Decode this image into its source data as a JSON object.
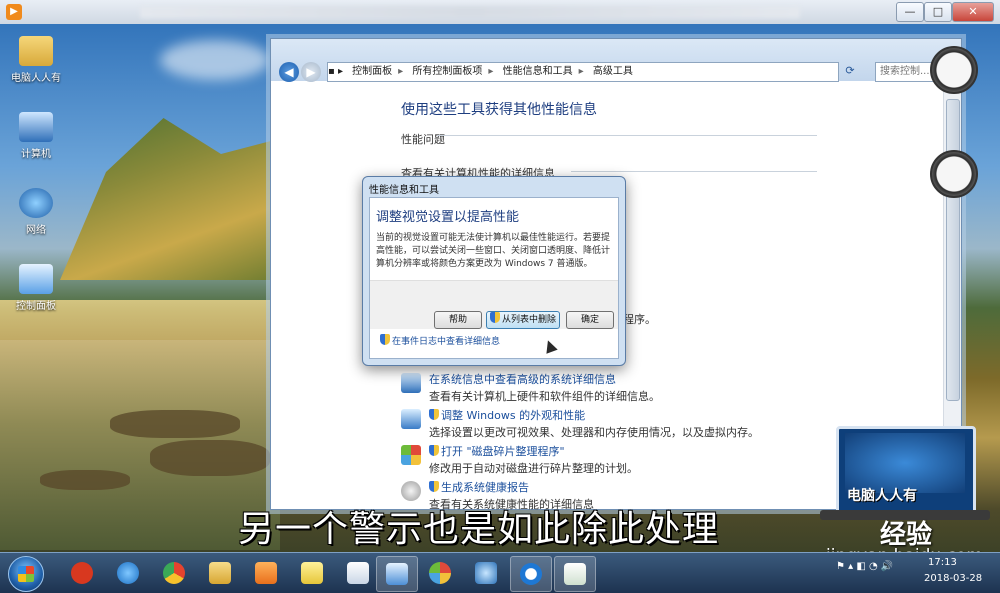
{
  "player": {
    "logo": "▶",
    "minimize": "—",
    "maximize": "□",
    "close": "✕"
  },
  "desktop_icons": [
    {
      "label": "电脑人人有"
    },
    {
      "label": "计算机"
    },
    {
      "label": "网络"
    },
    {
      "label": "控制面板"
    }
  ],
  "explorer": {
    "breadcrumb": [
      "控制面板",
      "所有控制面板项",
      "性能信息和工具",
      "高级工具"
    ],
    "search_placeholder": "搜索控制...",
    "pane_title": "使用这些工具获得其他性能信息",
    "group_issues": "性能问题",
    "group_details": "查看有关计算机性能的详细信息",
    "partial_text": "程序。",
    "tools": [
      {
        "link": "在系统信息中查看高级的系统详细信息",
        "desc": "查看有关计算机上硬件和软件组件的详细信息。",
        "icon": "system-info-icon",
        "shield": false
      },
      {
        "link": "调整 Windows 的外观和性能",
        "desc": "选择设置以更改可视效果、处理器和内存使用情况，以及虚拟内存。",
        "icon": "appearance-icon",
        "shield": true
      },
      {
        "link": "打开 \"磁盘碎片整理程序\"",
        "desc": "修改用于自动对磁盘进行碎片整理的计划。",
        "icon": "defrag-icon",
        "shield": true
      },
      {
        "link": "生成系统健康报告",
        "desc": "查看有关系统健康性能的详细信息",
        "icon": "health-report-icon",
        "shield": true
      }
    ]
  },
  "dialog": {
    "title": "性能信息和工具",
    "heading": "调整视觉设置以提高性能",
    "body": "当前的视觉设置可能无法使计算机以最佳性能运行。若要提高性能，可以尝试关闭一些窗口、关闭窗口透明度、降低计算机分辨率或将颜色方案更改为 Windows 7 普通版。",
    "buttons": {
      "help": "帮助",
      "list": "从列表中删除",
      "ok": "确定"
    },
    "event_log_link": "在事件日志中查看详细信息"
  },
  "subtitle": "另一个警示也是如此除此处理",
  "watermark": {
    "logo_text": "电脑人人有",
    "site": "经验",
    "url": "jingyan.baidu.com"
  },
  "taskbar": {
    "time": "17:13",
    "date": "2018-03-28",
    "items": [
      "sogou-icon",
      "ie-icon",
      "chrome-icon",
      "folder-icon",
      "media-icon",
      "notes-icon",
      "document-icon",
      "control-panel-icon",
      "paint-icon",
      "tool-icon",
      "cortana-icon",
      "explorer-window-icon"
    ]
  }
}
